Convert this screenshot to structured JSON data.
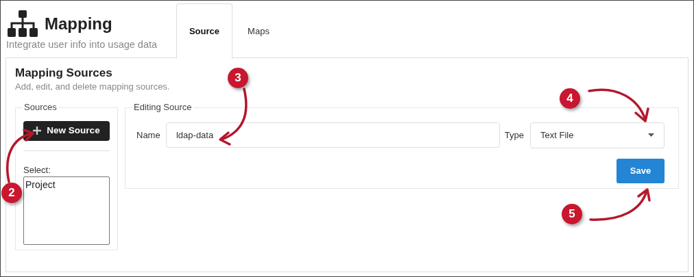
{
  "header": {
    "title": "Mapping",
    "subtitle": "Integrate user info into usage data"
  },
  "tabs": [
    {
      "label": "Source",
      "selected": true
    },
    {
      "label": "Maps",
      "selected": false
    }
  ],
  "section": {
    "title": "Mapping Sources",
    "subtitle": "Add, edit, and delete mapping sources."
  },
  "sources": {
    "legend": "Sources",
    "new_button": "New Source",
    "select_label": "Select:",
    "options": [
      {
        "label": "Project",
        "selected": false
      }
    ]
  },
  "editing": {
    "legend": "Editing Source",
    "name_label": "Name",
    "name_value": "ldap-data",
    "type_label": "Type",
    "type_value": "Text File",
    "save_button": "Save"
  },
  "callouts": [
    {
      "number": "3"
    },
    {
      "number": "2"
    },
    {
      "number": "4"
    },
    {
      "number": "5"
    }
  ]
}
